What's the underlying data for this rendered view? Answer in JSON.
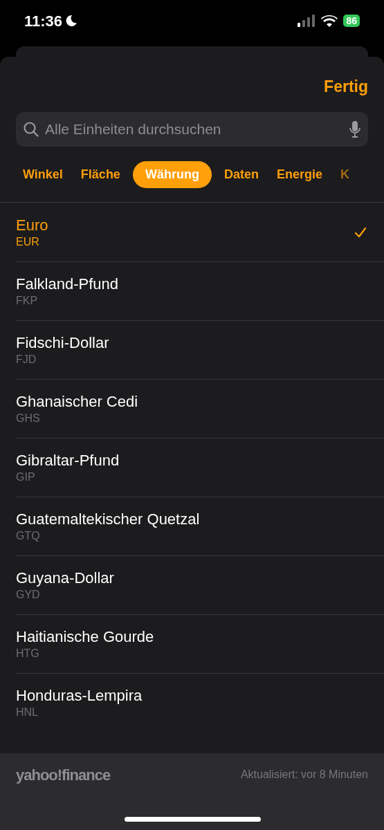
{
  "status_bar": {
    "time": "11:36",
    "battery": "86"
  },
  "header": {
    "done": "Fertig"
  },
  "search": {
    "placeholder": "Alle Einheiten durchsuchen"
  },
  "tabs": [
    {
      "label": "Winkel",
      "selected": false
    },
    {
      "label": "Fläche",
      "selected": false
    },
    {
      "label": "Währung",
      "selected": true
    },
    {
      "label": "Daten",
      "selected": false
    },
    {
      "label": "Energie",
      "selected": false
    },
    {
      "label": "K",
      "selected": false
    }
  ],
  "units": [
    {
      "name": "Euro",
      "code": "EUR",
      "selected": true
    },
    {
      "name": "Falkland-Pfund",
      "code": "FKP",
      "selected": false
    },
    {
      "name": "Fidschi-Dollar",
      "code": "FJD",
      "selected": false
    },
    {
      "name": "Ghanaischer Cedi",
      "code": "GHS",
      "selected": false
    },
    {
      "name": "Gibraltar-Pfund",
      "code": "GIP",
      "selected": false
    },
    {
      "name": "Guatemaltekischer Quetzal",
      "code": "GTQ",
      "selected": false
    },
    {
      "name": "Guyana-Dollar",
      "code": "GYD",
      "selected": false
    },
    {
      "name": "Haitianische Gourde",
      "code": "HTG",
      "selected": false
    },
    {
      "name": "Honduras-Lempira",
      "code": "HNL",
      "selected": false
    }
  ],
  "footer": {
    "logo": "yahoo!finance",
    "updated": "Aktualisiert: vor 8 Minuten"
  }
}
